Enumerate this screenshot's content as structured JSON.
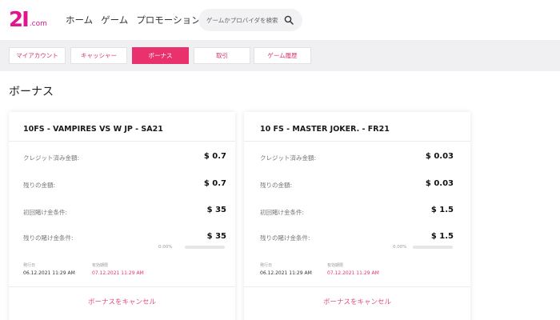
{
  "header": {
    "logo_main": "2I",
    "logo_suffix": ".com",
    "nav": [
      "ホーム",
      "ゲーム",
      "プロモーション"
    ],
    "search_placeholder": "ゲームかプロバイダを検索"
  },
  "tabs": [
    {
      "label": "マイアカウント",
      "active": false
    },
    {
      "label": "キャッシャー",
      "active": false
    },
    {
      "label": "ボーナス",
      "active": true
    },
    {
      "label": "取引",
      "active": false
    },
    {
      "label": "ゲーム履歴",
      "active": false
    }
  ],
  "page_title": "ボーナス",
  "bonuses": [
    {
      "title": "10FS - VAMPIRES VS W JP - SA21",
      "credited_label": "クレジット済み金額:",
      "credited_value": "$ 0.7",
      "remaining_label": "残りの金額:",
      "remaining_value": "$ 0.7",
      "initial_wager_label": "初回賭け金条件:",
      "initial_wager_value": "$ 35",
      "remaining_wager_label": "残りの賭け金条件:",
      "remaining_wager_value": "$ 35",
      "progress_text": "0.00%",
      "progress": 0,
      "issued_label": "発行日",
      "issued_value": "06.12.2021 11:29 AM",
      "expiry_label": "有効期限",
      "expiry_value": "07.12.2021 11:29 AM",
      "cancel_label": "ボーナスをキャンセル"
    },
    {
      "title": "10 FS - MASTER JOKER. - FR21",
      "credited_label": "クレジット済み金額:",
      "credited_value": "$ 0.03",
      "remaining_label": "残りの金額:",
      "remaining_value": "$ 0.03",
      "initial_wager_label": "初回賭け金条件:",
      "initial_wager_value": "$ 1.5",
      "remaining_wager_label": "残りの賭け金条件:",
      "remaining_wager_value": "$ 1.5",
      "progress_text": "0.00%",
      "progress": 0,
      "issued_label": "発行日",
      "issued_value": "06.12.2021 11:29 AM",
      "expiry_label": "有効期限",
      "expiry_value": "07.12.2021 11:29 AM",
      "cancel_label": "ボーナスをキャンセル"
    }
  ],
  "colors": {
    "brand": "#e2158f",
    "accent": "#e8316d",
    "expiry_text": "#e8316d"
  }
}
